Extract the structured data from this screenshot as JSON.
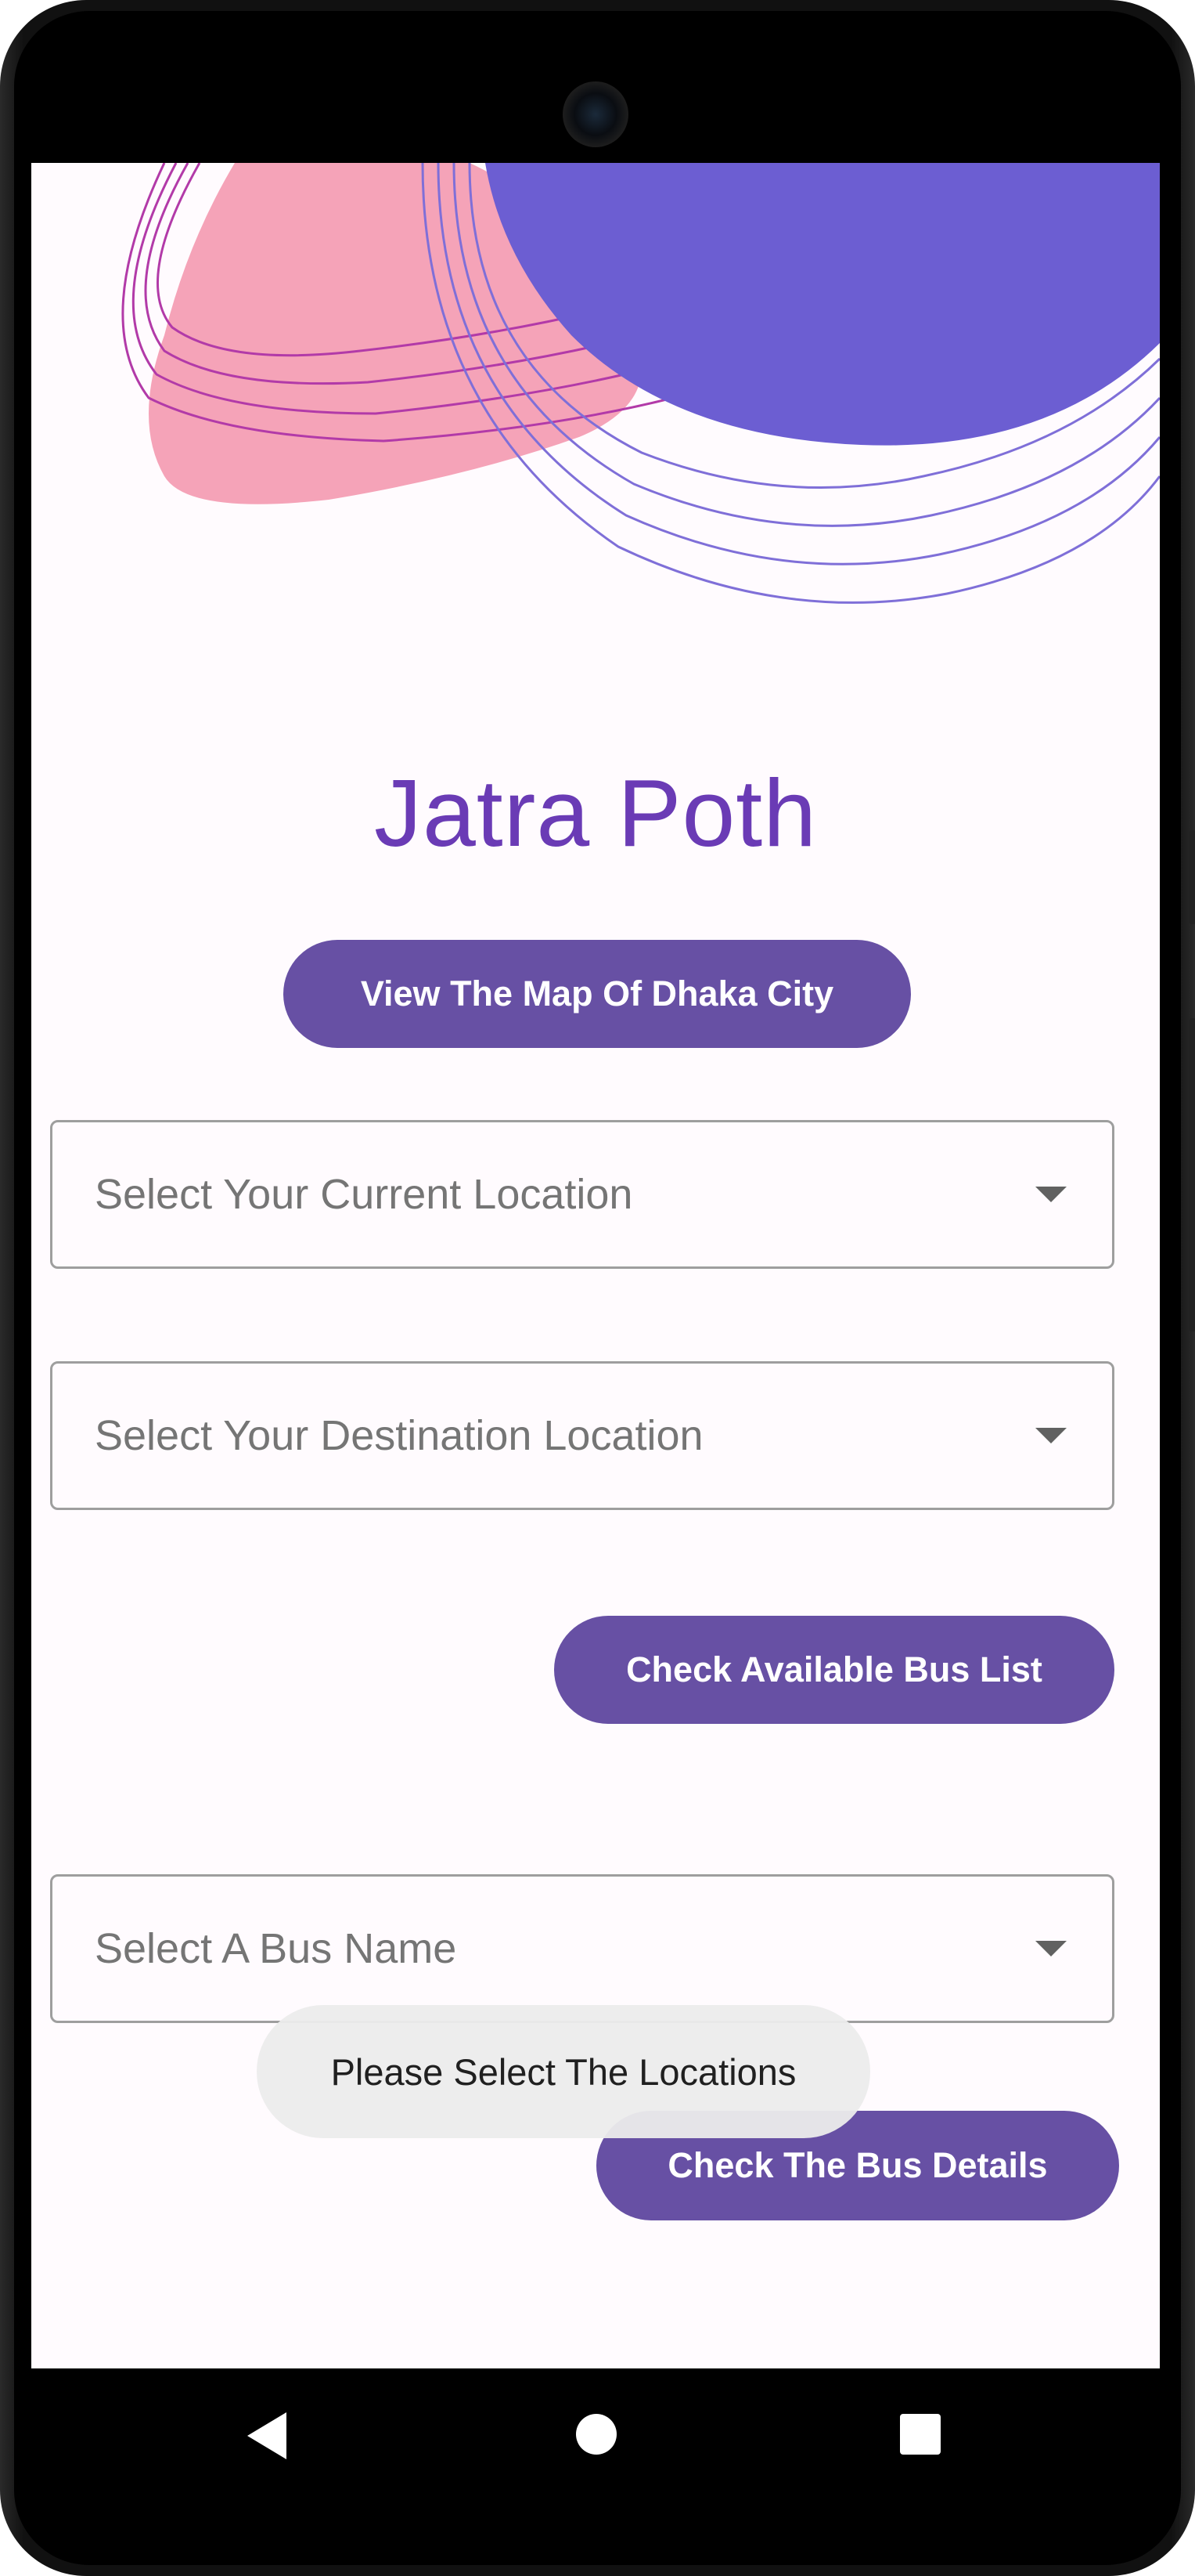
{
  "app": {
    "title": "Jatra Poth"
  },
  "buttons": {
    "view_map": "View The Map Of Dhaka City",
    "check_bus_list": "Check Available Bus List",
    "check_bus_details": "Check The Bus Details"
  },
  "dropdowns": {
    "current_location": "Select Your Current Location",
    "destination_location": "Select Your Destination Location",
    "bus_name": "Select A Bus Name"
  },
  "toast": {
    "message": "Please Select The Locations"
  },
  "navigation": {
    "back_icon": "back-triangle-icon",
    "home_icon": "home-circle-icon",
    "recents_icon": "recents-square-icon"
  },
  "colors": {
    "primary": "#6750a4",
    "title": "#6a3bb5",
    "blob_pink": "#f5a3b8",
    "blob_purple": "#6c5ed2",
    "background": "#fffbfe"
  }
}
